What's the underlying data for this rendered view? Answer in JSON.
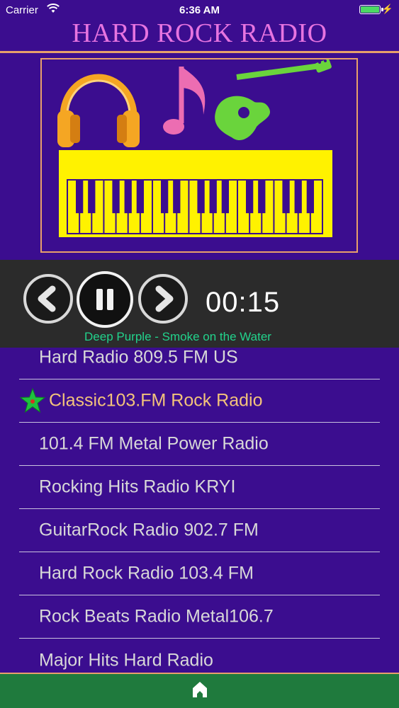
{
  "status_bar": {
    "carrier": "Carrier",
    "time": "6:36 AM",
    "battery_color": "#4cd964"
  },
  "app": {
    "title": "HARD ROCK RADIO",
    "title_color": "#e774e0",
    "accent": "#e8a06a",
    "background": "#3b0d8f"
  },
  "artwork": {
    "icons": [
      "headphones-icon",
      "music-note-icon",
      "guitar-icon",
      "keyboard-icon"
    ]
  },
  "player": {
    "prev_icon": "chevron-left-icon",
    "pause_icon": "pause-icon",
    "next_icon": "chevron-right-icon",
    "elapsed": "00:15",
    "now_playing": "Deep Purple - Smoke on the Water",
    "now_playing_color": "#22d38c"
  },
  "stations": [
    {
      "name": "Hard Radio 809.5 FM US",
      "favorite": false
    },
    {
      "name": "Classic103.FM Rock Radio",
      "favorite": true
    },
    {
      "name": "101.4 FM Metal Power Radio",
      "favorite": false
    },
    {
      "name": "Rocking Hits Radio KRYI",
      "favorite": false
    },
    {
      "name": "GuitarRock Radio 902.7 FM",
      "favorite": false
    },
    {
      "name": "Hard Rock Radio 103.4 FM",
      "favorite": false
    },
    {
      "name": "Rock Beats Radio Metal106.7",
      "favorite": false
    },
    {
      "name": "Major Hits Hard Radio",
      "favorite": false
    }
  ],
  "tab_bar": {
    "icon": "home-icon",
    "color": "#1f7a3d"
  }
}
